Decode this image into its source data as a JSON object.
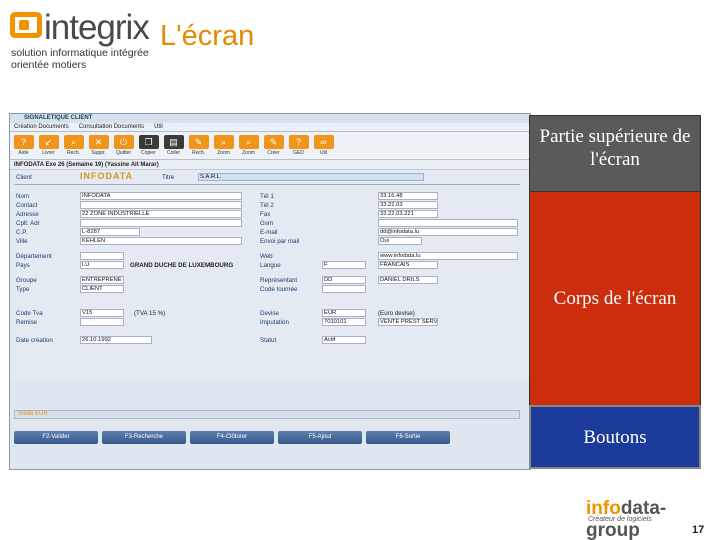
{
  "header": {
    "logo_word": "integrix",
    "logo_reg": "®",
    "tagline_1": "solution informatique intégrée",
    "tagline_2": "orientée motiers",
    "slide_title": "L'écran"
  },
  "window": {
    "title": "SIGNALETIQUE CLIENT",
    "menu": [
      "Création Documents",
      "Consultation Documents",
      "Util"
    ],
    "toolbar": [
      {
        "label": "Aide",
        "icon": "help-icon",
        "glyph": "?",
        "style": "orange"
      },
      {
        "label": "Livrer",
        "icon": "back-arrow-icon",
        "glyph": "↙",
        "style": "orange"
      },
      {
        "label": "Rech.",
        "icon": "search-icon",
        "glyph": "⌕",
        "style": "orange"
      },
      {
        "label": "Suppr.",
        "icon": "delete-icon",
        "glyph": "✕",
        "style": "orange"
      },
      {
        "label": "Quitter",
        "icon": "power-icon",
        "glyph": "⏻",
        "style": "orange"
      },
      {
        "label": "Copier",
        "icon": "copy-icon",
        "glyph": "❐",
        "style": "dark"
      },
      {
        "label": "Coller",
        "icon": "paste-icon",
        "glyph": "▤",
        "style": "dark"
      },
      {
        "label": "Rech.",
        "icon": "edit-icon",
        "glyph": "✎",
        "style": "orange"
      },
      {
        "label": "Zoom",
        "icon": "zoom-icon",
        "glyph": "⌕",
        "style": "orange"
      },
      {
        "label": "Zoom",
        "icon": "zoom-icon",
        "glyph": "⌕",
        "style": "orange"
      },
      {
        "label": "Créer",
        "icon": "create-icon",
        "glyph": "✎",
        "style": "orange"
      },
      {
        "label": "GED",
        "icon": "ged-icon",
        "glyph": "?",
        "style": "orange"
      },
      {
        "label": "Util",
        "icon": "link-icon",
        "glyph": "∞",
        "style": "orange"
      }
    ],
    "info_bar": "INFODATA   Exe 26 (Semaine 19)   (Yassine Ait Marar)",
    "form": {
      "client_label": "Client",
      "client_value": "INFODATA",
      "titre_label": "Titre",
      "titre_value": "S.A.R.L.",
      "left_labels": [
        "Nom",
        "Contact",
        "Adresse",
        "Cplt. Adr",
        "C.P.",
        "Ville",
        "Département",
        "Pays",
        "Groupe",
        "Type",
        "Code Tva",
        "Remise",
        "Date création"
      ],
      "left_values": {
        "nom": "INFODATA",
        "contact": "",
        "adresse": "22 ZONE INDUSTRIELLE",
        "cplt": "",
        "cp": "L-8287",
        "ville": "KEHLEN",
        "departement": "",
        "pays_code": "LU",
        "pays_name": "GRAND DUCHE DE LUXEMBOURG",
        "groupe": "ENTREPRENE",
        "type": "CLIENT",
        "tva_code": "V15",
        "tva_text": "(TVA 15 %)",
        "remise": "",
        "date_creation": "26.10.1992"
      },
      "right_labels": [
        "Tél 1",
        "Tél 2",
        "Fax",
        "Gsm",
        "E-mail",
        "Envoi par mail",
        "Web",
        "Langue",
        "Représentant",
        "Code tournée",
        "Devise",
        "Imputation",
        "Statut"
      ],
      "right_values": {
        "tel1": "33.16.48",
        "tel2": "33.22.03",
        "fax": "33.22.03.221",
        "gsm": "",
        "email": "dd@infodata.lu",
        "envoi": "Oui",
        "web": "www.infodata.lu",
        "langue_code": "F",
        "langue_name": "FRANCAIS",
        "rep_code": "DD",
        "rep_name": "DANIEL DRILS",
        "tournee": "",
        "devise_code": "EUR",
        "devise_name": "(Euro devise)",
        "imput_code": "7010101",
        "imput_name": "VENTE PREST SERVICES",
        "statut": "Actif"
      }
    },
    "solde": "Solde EUR",
    "bottom_buttons": [
      "F2-Valider",
      "F3-Recherche",
      "F4-Clôturer",
      "F5-Ajout",
      "F6-Sortie"
    ]
  },
  "panels": {
    "top": "Partie supérieure de l'écran",
    "middle": "Corps de l'écran",
    "bottom": "Boutons"
  },
  "footer": {
    "logo_info": "info",
    "logo_rest": "data-group",
    "tagline": "Créateur de logiciels",
    "page_number": "17"
  },
  "colors": {
    "accent_orange": "#f39200",
    "panel_gray": "#5a5a5a",
    "panel_red": "#cc2e0d",
    "panel_blue": "#1b3a9a"
  }
}
